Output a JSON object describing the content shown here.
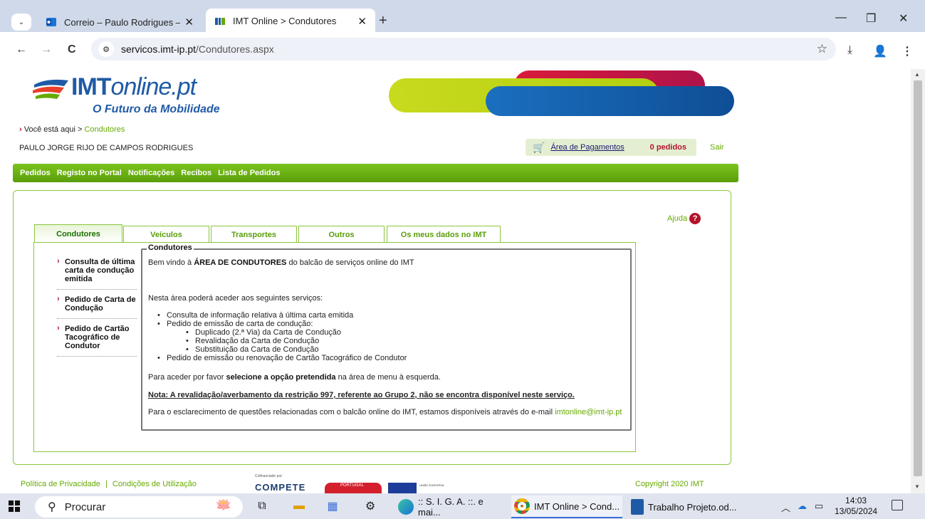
{
  "browser": {
    "tabs": [
      {
        "title": "Correio – Paulo Rodrigues – Ou",
        "active": false
      },
      {
        "title": "IMT Online > Condutores",
        "active": true
      }
    ],
    "url_host": "servicos.imt-ip.pt",
    "url_path": "/Condutores.aspx",
    "icons": {
      "tab_menu": "chevron-down-icon",
      "new_tab": "+",
      "minimize": "—",
      "restore": "❐",
      "close": "✕",
      "back": "←",
      "forward": "→",
      "reload": "C",
      "bookmark": "☆",
      "download": "⤓",
      "profile": "👤",
      "menu": "⋮"
    }
  },
  "page": {
    "logo": {
      "brand_imt": "IMT",
      "brand_online": "online.pt",
      "tagline": "O Futuro da Mobilidade"
    },
    "breadcrumb": {
      "prefix": "Você está aqui >",
      "current": "Condutores"
    },
    "user_name": "PAULO JORGE RIJO DE CAMPOS RODRIGUES",
    "payments": {
      "label": "Área de Pagamentos",
      "count": "0 pedidos"
    },
    "logout": "Sair",
    "nav": [
      "Pedidos",
      "Registo no Portal",
      "Notificações",
      "Recibos",
      "Lista de Pedidos"
    ],
    "help": "Ajuda",
    "tabs": [
      "Condutores",
      "Veículos",
      "Transportes",
      "Outros",
      "Os meus dados no IMT"
    ],
    "side_menu": [
      "Consulta de última carta de condução emitida",
      "Pedido de Carta de Condução",
      "Pedido de Cartão Tacográfico de Condutor"
    ],
    "fieldset": {
      "legend": "Condutores",
      "welcome_pre": "Bem vindo à ",
      "welcome_bold": "ÁREA DE CONDUTORES",
      "welcome_post": " do balcão de serviços online do IMT",
      "intro": "Nesta área poderá aceder aos seguintes serviços:",
      "services": [
        "Consulta de informação relativa à última carta emitida",
        "Pedido de emissão de carta de condução:",
        "Duplicado (2.ª Via) da Carta de Condução",
        "Revalidação da Carta de Condução",
        "Substituição da Carta de Condução",
        "Pedido de emissão ou renovação de Cartão Tacográfico de Condutor"
      ],
      "select_pre": "Para aceder por favor ",
      "select_bold": "selecione a opção pretendida",
      "select_post": " na área de menu à esquerda.",
      "note": "Nota: A revalidação/averbamento da restrição 997, referente ao Grupo 2, não se encontra disponível neste serviço.",
      "contact_pre": "Para o esclarecimento de questões relacionadas com o balcão online do IMT, estamos disponíveis através do e-mail ",
      "contact_email": "imtonline@imt-ip.pt"
    },
    "footer": {
      "privacy": "Política de Privacidade",
      "separator": "|",
      "terms": "Condições de Utilização",
      "cofin": "Cofinanciado por:",
      "compete": "COMPETE",
      "portugal": "PORTUGAL",
      "eu": "UNIÃO EUROPEIA",
      "copyright": "Copyright 2020 IMT"
    }
  },
  "taskbar": {
    "search_placeholder": "Procurar",
    "apps": [
      {
        "label": ":: S. I. G. A. ::. e mai...",
        "active": false
      },
      {
        "label": "IMT Online > Cond...",
        "active": true
      },
      {
        "label": "Trabalho Projeto.od...",
        "active": false
      }
    ],
    "time": "14:03",
    "date": "13/05/2024"
  },
  "colors": {
    "imt_green": "#66aa00",
    "imt_blue": "#1f5aa6",
    "imt_red": "#b3142a"
  }
}
